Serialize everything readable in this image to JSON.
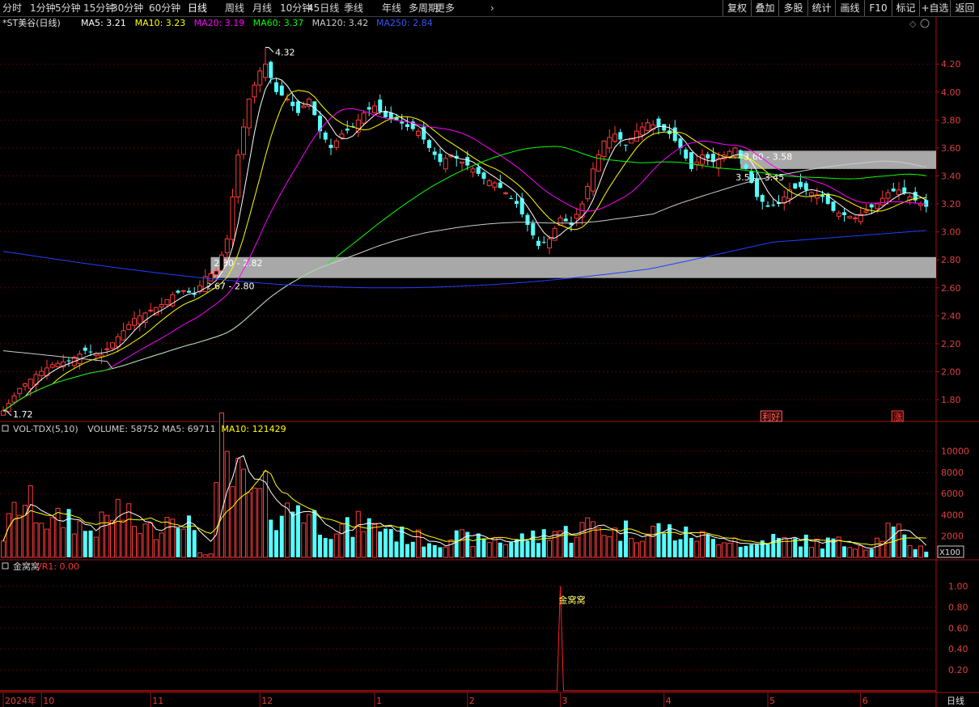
{
  "toolbar": {
    "periods": [
      "分时",
      "1分钟",
      "5分钟",
      "15分钟",
      "30分钟",
      "60分钟",
      "日线",
      "周线",
      "月线",
      "10分钟",
      "45日线",
      "季线",
      "年线",
      "多周期",
      "更多"
    ],
    "active": "日线",
    "more_arrow": "›",
    "right_buttons": [
      "复权",
      "叠加",
      "多股",
      "统计",
      "画线",
      "F10",
      "标记",
      "+自选",
      "返回"
    ]
  },
  "main_header": {
    "title": "*ST美谷(日线)",
    "ma_labels": [
      {
        "text": "MA5: 3.21",
        "color": "#ffffff"
      },
      {
        "text": "MA10: 3.23",
        "color": "#ffff00"
      },
      {
        "text": "MA20: 3.19",
        "color": "#ff00ff"
      },
      {
        "text": "MA60: 3.37",
        "color": "#00ff00"
      },
      {
        "text": "MA120: 3.42",
        "color": "#cccccc"
      },
      {
        "text": "MA250: 2.84",
        "color": "#3355ff"
      }
    ],
    "controls": [
      "◇",
      "⊕"
    ]
  },
  "vol_header": {
    "labels": [
      {
        "text": "VOL-TDX(5,10)",
        "color": "#cccccc"
      },
      {
        "text": "VOLUME: 58752",
        "color": "#cccccc"
      },
      {
        "text": "MA5: 69711",
        "color": "#cccccc"
      },
      {
        "text": "MA10: 121429",
        "color": "#ffff00"
      }
    ],
    "unit": "X100"
  },
  "ind_header": {
    "labels": [
      {
        "text": "金窝窝",
        "color": "#cccccc"
      },
      {
        "text": "VR1: 0.00",
        "color": "#ff3333"
      }
    ],
    "signal_label": "金窝窝"
  },
  "x_axis": {
    "labels": [
      {
        "text": "2024年",
        "index": 0
      },
      {
        "text": "10",
        "index": 7
      },
      {
        "text": "11",
        "index": 27
      },
      {
        "text": "12",
        "index": 47
      },
      {
        "text": "1",
        "index": 68
      },
      {
        "text": "2",
        "index": 85
      },
      {
        "text": "3",
        "index": 102
      },
      {
        "text": "4",
        "index": 121
      },
      {
        "text": "5",
        "index": 140
      },
      {
        "text": "6",
        "index": 157
      }
    ],
    "period_label": "日线"
  },
  "chart_data": {
    "type": "candlestick",
    "price_axis": {
      "ticks": [
        4.2,
        4.0,
        3.8,
        3.6,
        3.4,
        3.2,
        3.0,
        2.8,
        2.6,
        2.4,
        2.2,
        2.0,
        1.8
      ],
      "ylim": [
        1.65,
        4.45
      ]
    },
    "volume_axis": {
      "ticks": [
        10000,
        8000,
        6000,
        4000,
        2000
      ],
      "ylim": [
        0,
        11500
      ],
      "unit": "X100"
    },
    "indicator_axis": {
      "ticks": [
        1.0,
        0.8,
        0.6,
        0.4,
        0.2
      ],
      "ylim": [
        0,
        1.12
      ]
    },
    "highlights": [
      {
        "text": "4.32",
        "index": 48,
        "price": 4.32
      },
      {
        "text": "1.72",
        "index": 0,
        "price": 1.72
      }
    ],
    "zones": [
      {
        "low": 2.67,
        "high": 2.82,
        "label_top": "2.80 - 2.82",
        "label_bottom": "2.67 - 2.80",
        "start_index": 38
      },
      {
        "low": 3.45,
        "high": 3.58,
        "label_top": "3.60 - 3.58",
        "label_bottom": "3.54 - 3.45",
        "start_index": 135
      }
    ],
    "markers": [
      {
        "text": "利好",
        "index": 139,
        "color": "#ff6666"
      },
      {
        "text": "涨",
        "index": 163,
        "color": "#ff4444"
      }
    ],
    "indicator_signal": {
      "index": 102,
      "value": 1.0
    },
    "close_anchors": [
      [
        0,
        1.72
      ],
      [
        3,
        1.88
      ],
      [
        6,
        1.98
      ],
      [
        9,
        2.05
      ],
      [
        12,
        2.08
      ],
      [
        15,
        2.15
      ],
      [
        18,
        2.12
      ],
      [
        21,
        2.25
      ],
      [
        24,
        2.38
      ],
      [
        26,
        2.42
      ],
      [
        29,
        2.48
      ],
      [
        31,
        2.55
      ],
      [
        33,
        2.58
      ],
      [
        35,
        2.55
      ],
      [
        37,
        2.68
      ],
      [
        39,
        2.72
      ],
      [
        41,
        2.95
      ],
      [
        43,
        3.55
      ],
      [
        45,
        3.95
      ],
      [
        47,
        4.15
      ],
      [
        48,
        4.2
      ],
      [
        50,
        4.0
      ],
      [
        52,
        3.95
      ],
      [
        54,
        3.85
      ],
      [
        56,
        3.95
      ],
      [
        58,
        3.72
      ],
      [
        60,
        3.6
      ],
      [
        62,
        3.7
      ],
      [
        64,
        3.75
      ],
      [
        66,
        3.85
      ],
      [
        68,
        3.9
      ],
      [
        70,
        3.82
      ],
      [
        72,
        3.8
      ],
      [
        74,
        3.75
      ],
      [
        76,
        3.72
      ],
      [
        78,
        3.6
      ],
      [
        80,
        3.5
      ],
      [
        82,
        3.55
      ],
      [
        84,
        3.5
      ],
      [
        86,
        3.45
      ],
      [
        88,
        3.38
      ],
      [
        90,
        3.35
      ],
      [
        92,
        3.28
      ],
      [
        94,
        3.2
      ],
      [
        96,
        3.05
      ],
      [
        98,
        2.9
      ],
      [
        100,
        2.95
      ],
      [
        102,
        3.1
      ],
      [
        104,
        3.05
      ],
      [
        106,
        3.2
      ],
      [
        108,
        3.45
      ],
      [
        110,
        3.65
      ],
      [
        112,
        3.7
      ],
      [
        114,
        3.62
      ],
      [
        116,
        3.72
      ],
      [
        118,
        3.78
      ],
      [
        120,
        3.75
      ],
      [
        122,
        3.7
      ],
      [
        124,
        3.6
      ],
      [
        126,
        3.45
      ],
      [
        128,
        3.55
      ],
      [
        130,
        3.5
      ],
      [
        132,
        3.55
      ],
      [
        134,
        3.6
      ],
      [
        136,
        3.45
      ],
      [
        138,
        3.25
      ],
      [
        140,
        3.18
      ],
      [
        142,
        3.2
      ],
      [
        144,
        3.3
      ],
      [
        146,
        3.32
      ],
      [
        148,
        3.28
      ],
      [
        150,
        3.25
      ],
      [
        152,
        3.15
      ],
      [
        154,
        3.12
      ],
      [
        156,
        3.1
      ],
      [
        158,
        3.15
      ],
      [
        160,
        3.2
      ],
      [
        162,
        3.28
      ],
      [
        164,
        3.3
      ],
      [
        166,
        3.25
      ],
      [
        168,
        3.2
      ],
      [
        169,
        3.18
      ]
    ],
    "volume_anchors": [
      [
        0,
        2000
      ],
      [
        3,
        5200
      ],
      [
        6,
        4500
      ],
      [
        9,
        3000
      ],
      [
        12,
        4000
      ],
      [
        15,
        2500
      ],
      [
        18,
        3000
      ],
      [
        21,
        4500
      ],
      [
        24,
        3000
      ],
      [
        27,
        2500
      ],
      [
        30,
        3800
      ],
      [
        32,
        5000
      ],
      [
        34,
        3200
      ],
      [
        36,
        500
      ],
      [
        38,
        300
      ],
      [
        40,
        10000
      ],
      [
        42,
        7200
      ],
      [
        44,
        6400
      ],
      [
        46,
        5200
      ],
      [
        48,
        5600
      ],
      [
        50,
        4500
      ],
      [
        52,
        4200
      ],
      [
        54,
        5300
      ],
      [
        56,
        4000
      ],
      [
        58,
        3300
      ],
      [
        60,
        3000
      ],
      [
        62,
        2800
      ],
      [
        64,
        2600
      ],
      [
        66,
        3500
      ],
      [
        68,
        2700
      ],
      [
        70,
        3000
      ],
      [
        72,
        2200
      ],
      [
        74,
        2000
      ],
      [
        76,
        1800
      ],
      [
        78,
        1600
      ],
      [
        80,
        1500
      ],
      [
        82,
        2000
      ],
      [
        84,
        1800
      ],
      [
        86,
        1700
      ],
      [
        88,
        1500
      ],
      [
        90,
        1800
      ],
      [
        92,
        1400
      ],
      [
        94,
        1700
      ],
      [
        96,
        2000
      ],
      [
        98,
        1800
      ],
      [
        100,
        2600
      ],
      [
        102,
        2500
      ],
      [
        104,
        2200
      ],
      [
        106,
        2800
      ],
      [
        108,
        3100
      ],
      [
        110,
        2700
      ],
      [
        112,
        2300
      ],
      [
        114,
        2600
      ],
      [
        116,
        2400
      ],
      [
        118,
        2200
      ],
      [
        120,
        2800
      ],
      [
        122,
        2500
      ],
      [
        124,
        2000
      ],
      [
        126,
        2200
      ],
      [
        128,
        1900
      ],
      [
        130,
        1600
      ],
      [
        132,
        2000
      ],
      [
        134,
        1800
      ],
      [
        136,
        1000
      ],
      [
        138,
        1200
      ],
      [
        140,
        1900
      ],
      [
        142,
        1600
      ],
      [
        144,
        1500
      ],
      [
        146,
        1700
      ],
      [
        148,
        1400
      ],
      [
        150,
        1300
      ],
      [
        152,
        1600
      ],
      [
        154,
        1200
      ],
      [
        156,
        1400
      ],
      [
        158,
        1000
      ],
      [
        160,
        1600
      ],
      [
        162,
        2600
      ],
      [
        164,
        2200
      ],
      [
        166,
        1300
      ],
      [
        168,
        900
      ],
      [
        169,
        800
      ]
    ]
  }
}
